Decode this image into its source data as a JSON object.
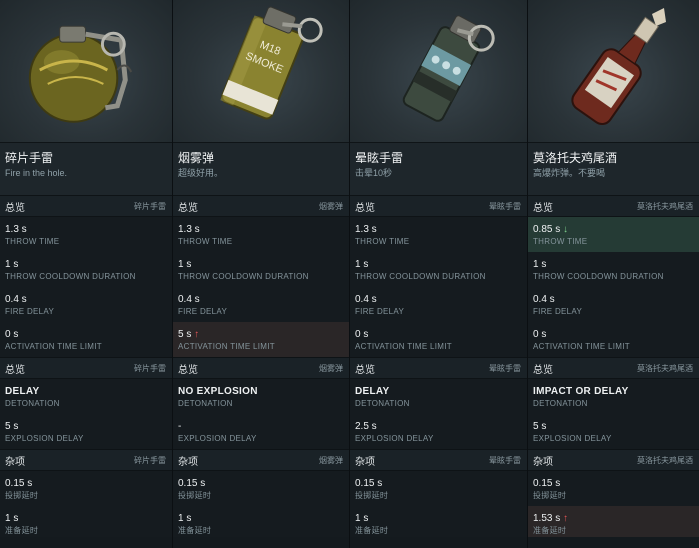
{
  "columns": [
    {
      "name": "碎片手雷",
      "desc": "Fire in the hole.",
      "tag": "碎片手雷",
      "overview": [
        {
          "value": "1.3 s",
          "label": "THROW TIME",
          "state": "normal"
        },
        {
          "value": "1 s",
          "label": "THROW COOLDOWN DURATION",
          "state": "normal"
        },
        {
          "value": "0.4 s",
          "label": "FIRE DELAY",
          "state": "normal"
        },
        {
          "value": "0 s",
          "label": "ACTIVATION TIME LIMIT",
          "state": "normal"
        }
      ],
      "detonation": {
        "value": "DELAY",
        "label": "DETONATION"
      },
      "explosion": {
        "value": "5 s",
        "label": "EXPLOSION DELAY"
      },
      "misc": [
        {
          "value": "0.15 s",
          "label": "投掷延时",
          "state": "normal"
        },
        {
          "value": "1 s",
          "label": "准备延时",
          "state": "normal"
        }
      ]
    },
    {
      "name": "烟雾弹",
      "desc": "超级好用。",
      "tag": "烟雾弹",
      "overview": [
        {
          "value": "1.3 s",
          "label": "THROW TIME",
          "state": "normal"
        },
        {
          "value": "1 s",
          "label": "THROW COOLDOWN DURATION",
          "state": "normal"
        },
        {
          "value": "0.4 s",
          "label": "FIRE DELAY",
          "state": "normal"
        },
        {
          "value": "5 s",
          "label": "ACTIVATION TIME LIMIT",
          "state": "worse"
        }
      ],
      "detonation": {
        "value": "NO EXPLOSION",
        "label": "DETONATION"
      },
      "explosion": {
        "value": "-",
        "label": "EXPLOSION DELAY"
      },
      "misc": [
        {
          "value": "0.15 s",
          "label": "投掷延时",
          "state": "normal"
        },
        {
          "value": "1 s",
          "label": "准备延时",
          "state": "normal"
        }
      ]
    },
    {
      "name": "晕眩手雷",
      "desc": "击晕10秒",
      "tag": "晕眩手雷",
      "overview": [
        {
          "value": "1.3 s",
          "label": "THROW TIME",
          "state": "normal"
        },
        {
          "value": "1 s",
          "label": "THROW COOLDOWN DURATION",
          "state": "normal"
        },
        {
          "value": "0.4 s",
          "label": "FIRE DELAY",
          "state": "normal"
        },
        {
          "value": "0 s",
          "label": "ACTIVATION TIME LIMIT",
          "state": "normal"
        }
      ],
      "detonation": {
        "value": "DELAY",
        "label": "DETONATION"
      },
      "explosion": {
        "value": "2.5 s",
        "label": "EXPLOSION DELAY"
      },
      "misc": [
        {
          "value": "0.15 s",
          "label": "投掷延时",
          "state": "normal"
        },
        {
          "value": "1 s",
          "label": "准备延时",
          "state": "normal"
        }
      ]
    },
    {
      "name": "莫洛托夫鸡尾酒",
      "desc": "高爆炸弹。不要喝",
      "tag": "莫洛托夫鸡尾酒",
      "overview": [
        {
          "value": "0.85 s",
          "label": "THROW TIME",
          "state": "better"
        },
        {
          "value": "1 s",
          "label": "THROW COOLDOWN DURATION",
          "state": "normal"
        },
        {
          "value": "0.4 s",
          "label": "FIRE DELAY",
          "state": "normal"
        },
        {
          "value": "0 s",
          "label": "ACTIVATION TIME LIMIT",
          "state": "normal"
        }
      ],
      "detonation": {
        "value": "IMPACT OR DELAY",
        "label": "DETONATION"
      },
      "explosion": {
        "value": "5 s",
        "label": "EXPLOSION DELAY"
      },
      "misc": [
        {
          "value": "0.15 s",
          "label": "投掷延时",
          "state": "normal"
        },
        {
          "value": "1.53 s",
          "label": "准备延时",
          "state": "worse"
        }
      ]
    }
  ],
  "sections": {
    "overview": "总览",
    "misc": "杂项"
  },
  "arrows": {
    "up": "↑",
    "down": "↓"
  },
  "images": {
    "frag": {
      "icon": "frag-grenade-icon",
      "label": ""
    },
    "smoke": {
      "icon": "smoke-grenade-icon",
      "label": "M18\nSMOKE"
    },
    "stun": {
      "icon": "stun-grenade-icon",
      "label": ""
    },
    "molotov": {
      "icon": "molotov-cocktail-icon",
      "label": ""
    }
  },
  "colors": {
    "better_bg": "#253b35",
    "worse_bg": "#2a2627",
    "up_arrow": "#e25555",
    "down_arrow": "#7fd18d"
  }
}
